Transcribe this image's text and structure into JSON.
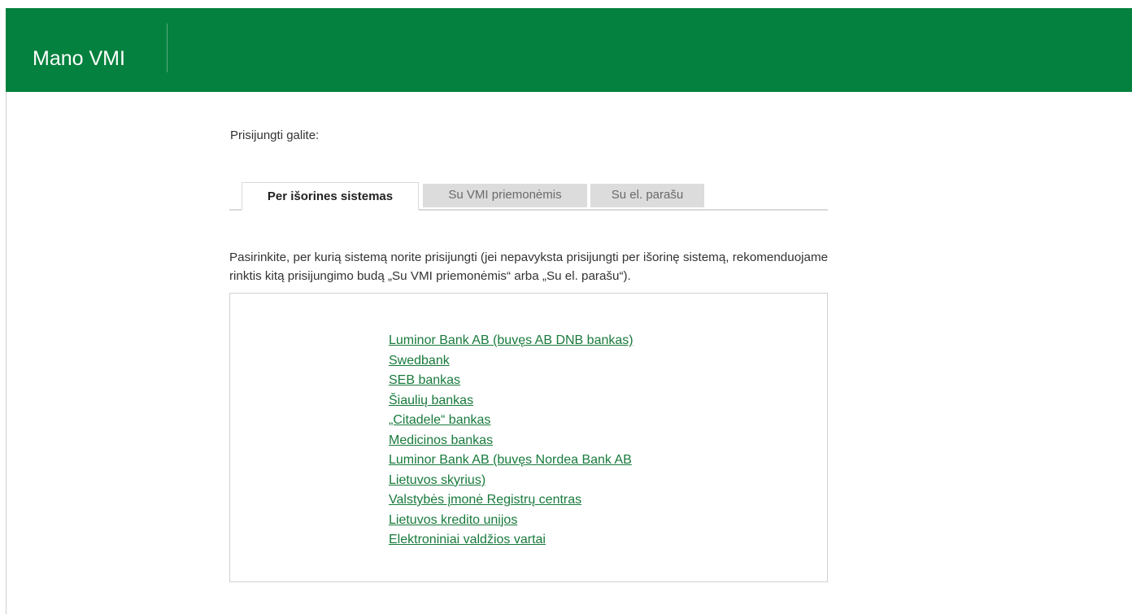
{
  "header": {
    "title": "Mano VMI",
    "brand_color": "#04813e"
  },
  "intro": "Prisijungti galite:",
  "tabs": [
    {
      "label": "Per išorines sistemas",
      "active": true
    },
    {
      "label": "Su VMI priemonėmis",
      "active": false
    },
    {
      "label": "Su el. parašu",
      "active": false
    }
  ],
  "instruction": "Pasirinkite, per kurią sistemą norite prisijungti (jei nepavyksta prisijungti per išorinę sistemą, rekomenduojame rinktis kitą prisijungimo budą „Su VMI priemonėmis“ arba „Su el. parašu“).",
  "banks": [
    "Luminor Bank AB (buvęs AB DNB bankas)",
    "Swedbank ",
    "SEB bankas ",
    "Šiaulių bankas ",
    "„Citadele“ bankas ",
    "Medicinos bankas ",
    "Luminor Bank AB (buvęs Nordea Bank AB",
    "Lietuvos skyrius) ",
    "Valstybės įmonė Registrų centras ",
    "Lietuvos kredito unijos ",
    "Elektroniniai valdžios vartai "
  ],
  "link_color": "#187a3c"
}
